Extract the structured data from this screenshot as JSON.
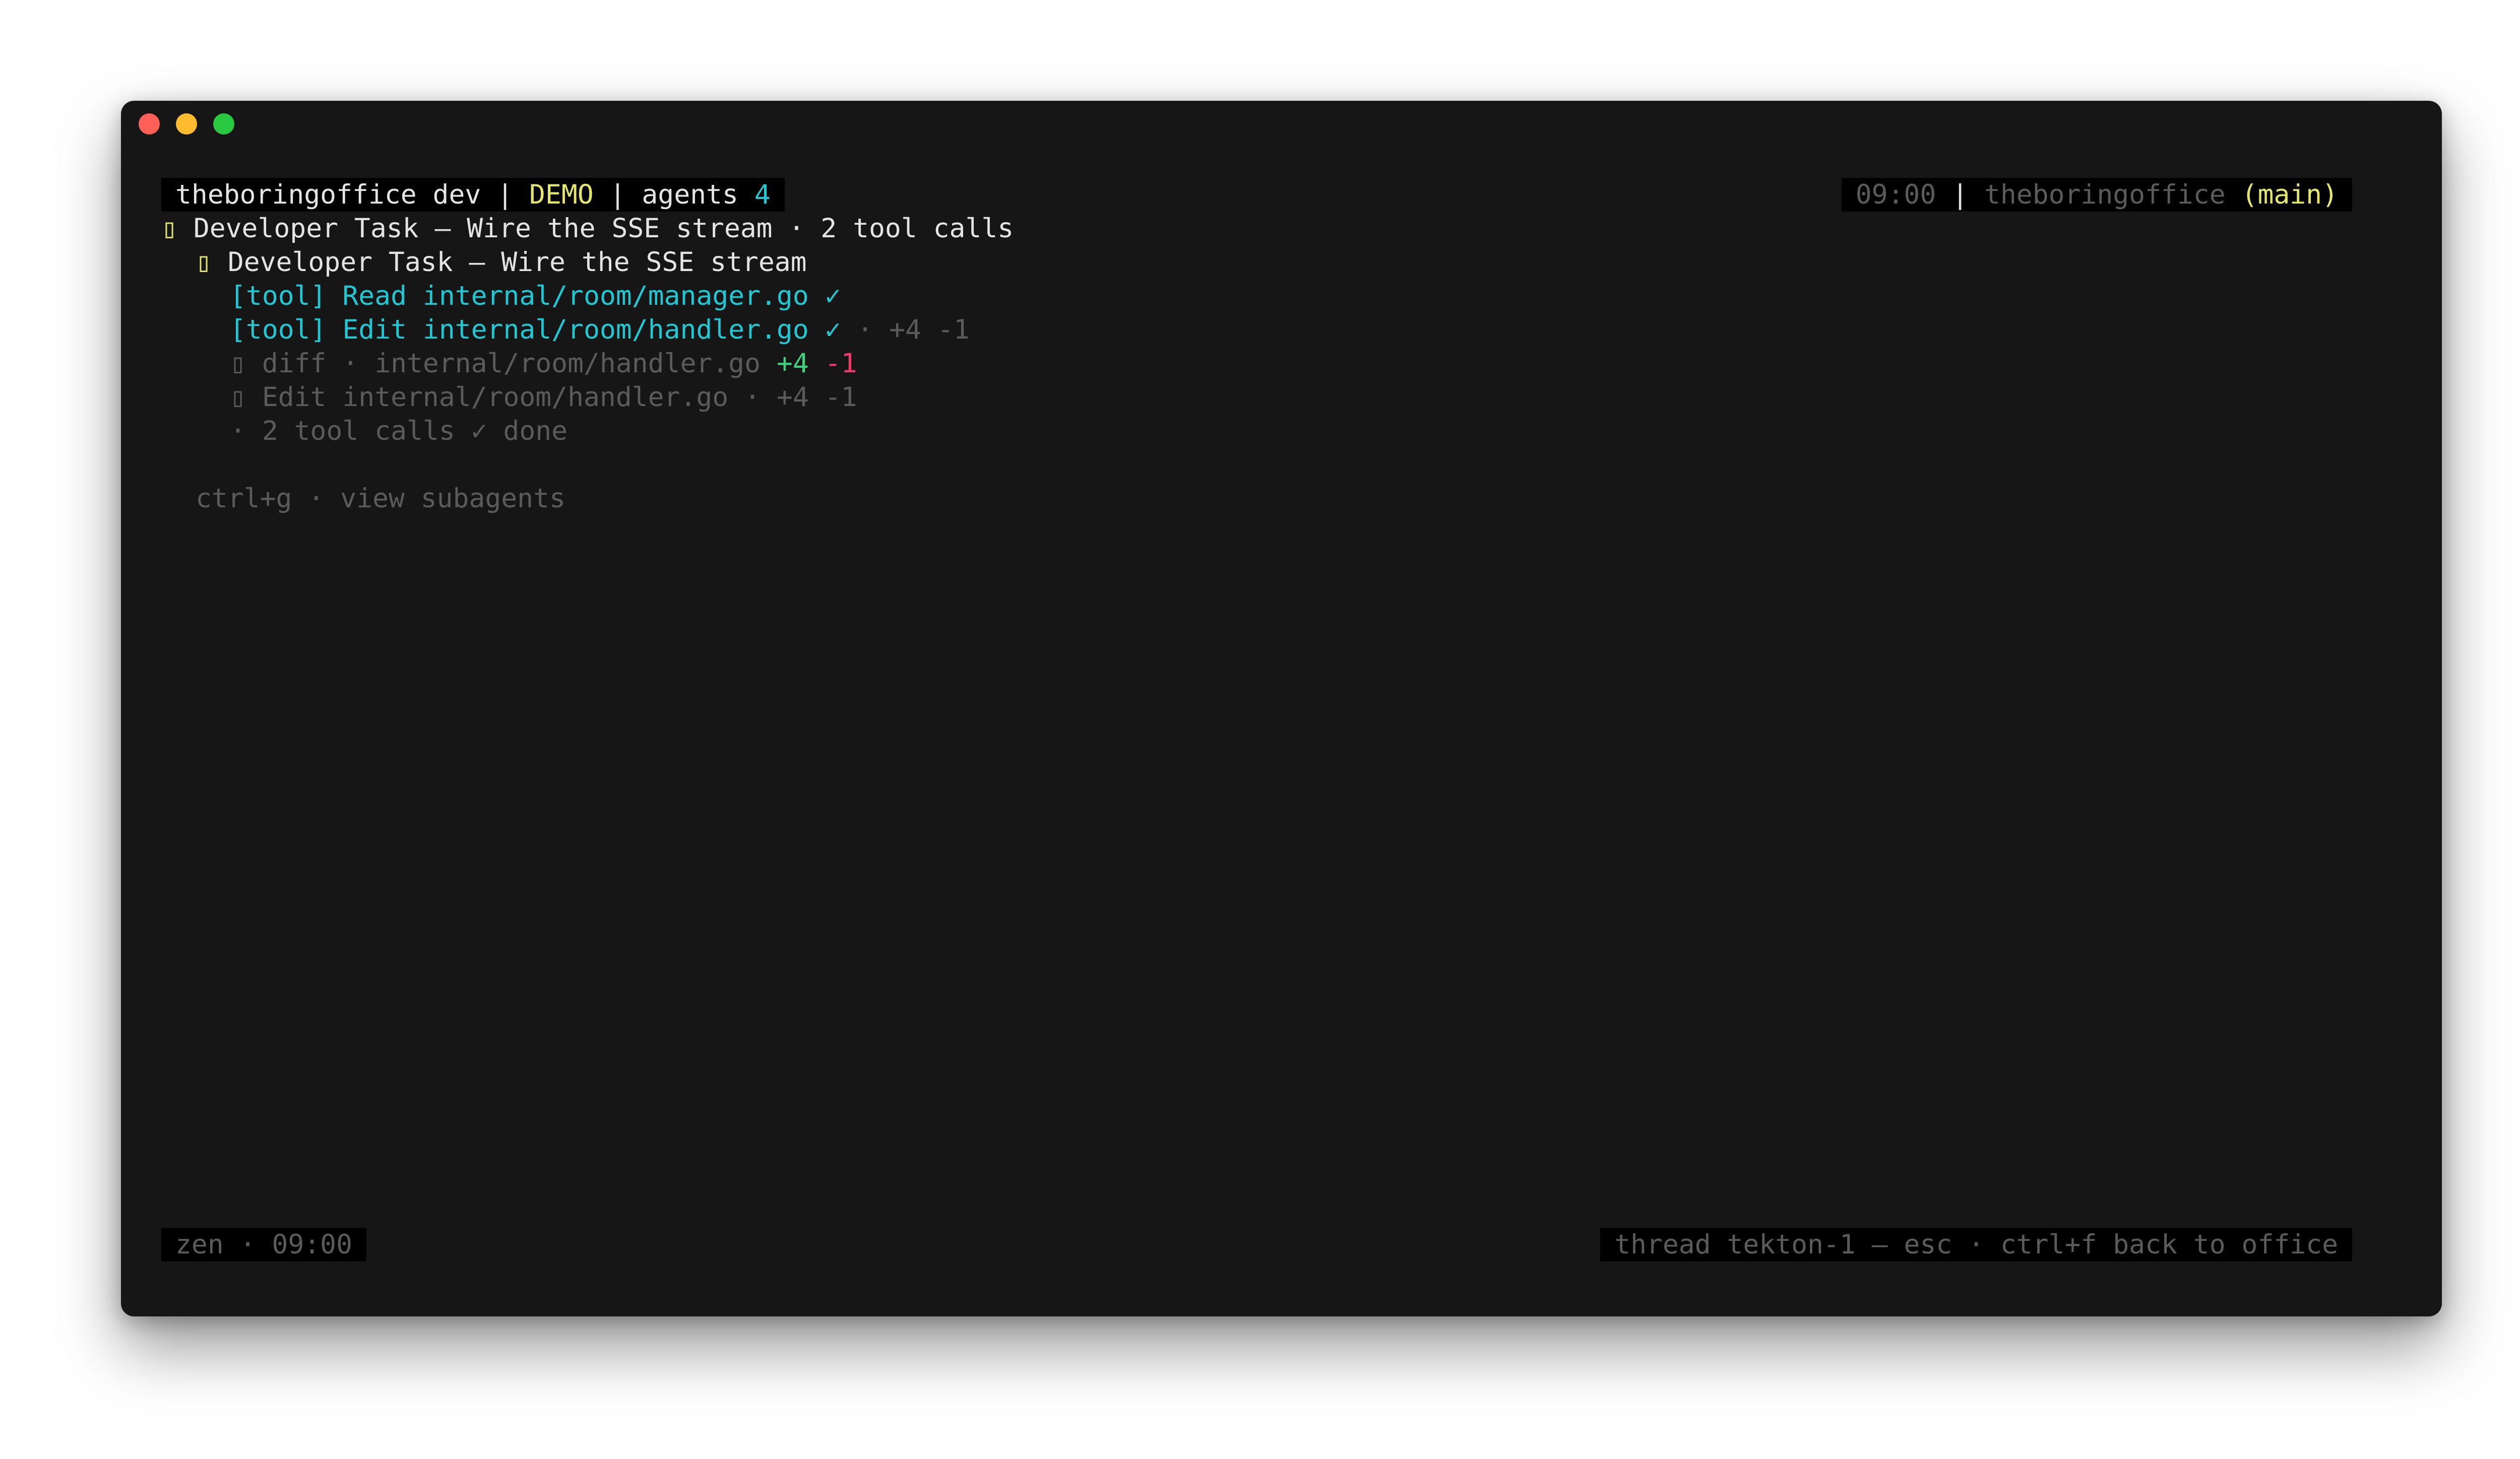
{
  "header": {
    "app": "theboringoffice dev",
    "sep1": " | ",
    "mode": "DEMO",
    "sep2": " | ",
    "agents_label": "agents ",
    "agents_count": "4",
    "time": "09:00",
    "sep3": " | ",
    "repo": "theboringoffice",
    "branch": "(main)"
  },
  "tree": {
    "root_icon": "▯",
    "root_text": " Developer Task — Wire the SSE stream · 2 tool calls",
    "child_icon": "▯",
    "child_text": " Developer Task — Wire the SSE stream",
    "tool1": "[tool] Read internal/room/manager.go",
    "tool1_check": " ✓",
    "tool2": "[tool] Edit internal/room/handler.go",
    "tool2_check": " ✓",
    "tool2_meta": " · +4 -1",
    "diff_icon": "▯",
    "diff_text": " diff · internal/room/handler.go ",
    "diff_add": "+4",
    "diff_del": "-1",
    "edit_icon": "▯",
    "edit_text": " Edit internal/room/handler.go · +4 -1",
    "summary": "· 2 tool calls ✓ done",
    "hint": "ctrl+g · view subagents"
  },
  "footer": {
    "left": "zen · 09:00",
    "right": "thread tekton-1 — esc · ctrl+f back to office"
  },
  "colors": {
    "background": "#161616",
    "bar_bg": "#000000",
    "yellow": "#e4e56d",
    "cyan": "#21c7d2",
    "green": "#41d17e",
    "red": "#f0386b",
    "dim": "#5b5b5b"
  }
}
